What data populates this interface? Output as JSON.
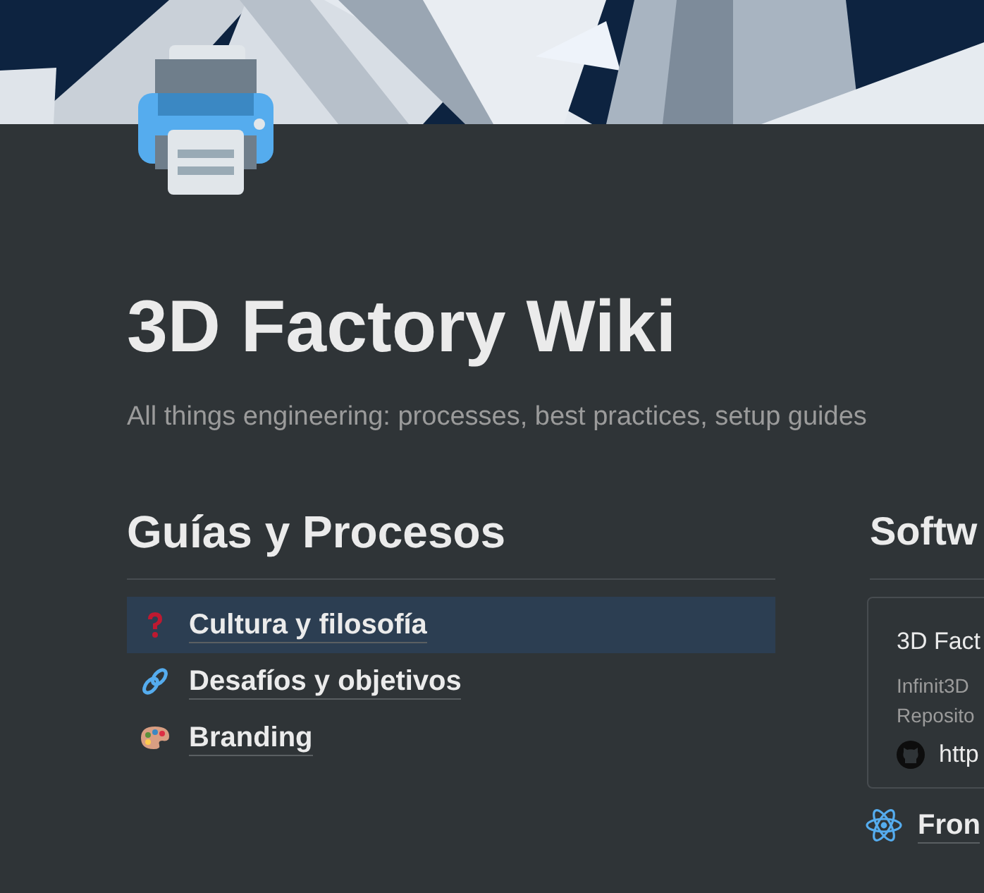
{
  "page": {
    "title": "3D Factory Wiki",
    "description": "All things engineering: processes, best practices, setup guides"
  },
  "columns": [
    {
      "heading": "Guías y Procesos",
      "links": [
        {
          "label": "Cultura y filosofía",
          "selected": true
        },
        {
          "label": "Desafíos y objetivos",
          "selected": false
        },
        {
          "label": "Branding",
          "selected": false
        }
      ]
    },
    {
      "heading": "Softw",
      "card": {
        "title": "3D Fact",
        "lines": [
          "Infinit3D",
          "Reposito"
        ],
        "link": "http"
      },
      "links": [
        {
          "label": "Fron",
          "selected": false
        }
      ]
    }
  ]
}
